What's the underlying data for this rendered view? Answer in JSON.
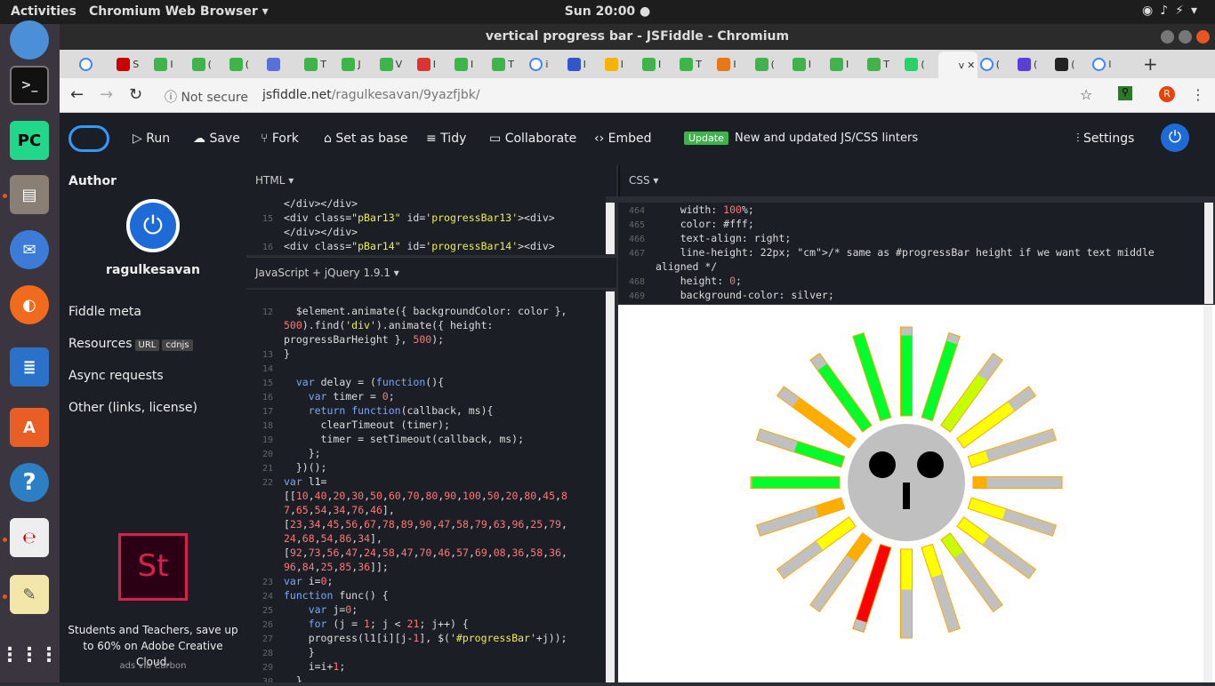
{
  "system": {
    "activities": "Activities",
    "app_menu": "Chromium Web Browser ▾",
    "clock": "Sun 20:00 ●"
  },
  "window": {
    "title": "vertical progress bar - JSFiddle - Chromium"
  },
  "tabs": [
    {
      "letter": "",
      "color": "#fff",
      "active": false
    },
    {
      "letter": "S",
      "color": "#c00",
      "active": false
    },
    {
      "letter": "I",
      "color": "#3fb44a",
      "active": false
    },
    {
      "letter": "(",
      "color": "#3fb44a",
      "active": false
    },
    {
      "letter": "(",
      "color": "#3fb44a",
      "active": false
    },
    {
      "letter": "",
      "color": "#5a6fd8",
      "active": false
    },
    {
      "letter": "T",
      "color": "#3fb44a",
      "active": false
    },
    {
      "letter": "J",
      "color": "#3fb44a",
      "active": false
    },
    {
      "letter": "V",
      "color": "#3fb44a",
      "active": false
    },
    {
      "letter": "I",
      "color": "#d33",
      "active": false
    },
    {
      "letter": "I",
      "color": "#3fb44a",
      "active": false
    },
    {
      "letter": "T",
      "color": "#3fb44a",
      "active": false
    },
    {
      "letter": "i",
      "color": "#fff",
      "active": false
    },
    {
      "letter": "I",
      "color": "#3355cc",
      "active": false
    },
    {
      "letter": "I",
      "color": "#f5b400",
      "active": false
    },
    {
      "letter": "I",
      "color": "#3fb44a",
      "active": false
    },
    {
      "letter": "T",
      "color": "#3fb44a",
      "active": false
    },
    {
      "letter": "I",
      "color": "#e8771a",
      "active": false
    },
    {
      "letter": "(",
      "color": "#3fb44a",
      "active": false
    },
    {
      "letter": "I",
      "color": "#3fb44a",
      "active": false
    },
    {
      "letter": "I",
      "color": "#3fb44a",
      "active": false
    },
    {
      "letter": "T",
      "color": "#3fb44a",
      "active": false
    },
    {
      "letter": "(",
      "color": "#25d366",
      "active": false
    },
    {
      "letter": "v",
      "color": "#f4f4f4",
      "active": true
    },
    {
      "letter": "(",
      "color": "#fff",
      "active": false
    },
    {
      "letter": "(",
      "color": "#5a3fd8",
      "active": false
    },
    {
      "letter": "(",
      "color": "#222",
      "active": false
    },
    {
      "letter": "l",
      "color": "#fff",
      "active": false
    }
  ],
  "omnibox": {
    "security": "Not secure",
    "host": "jsfiddle.net",
    "path": "/ragulkesavan/9yazfjbk/",
    "profile": "R"
  },
  "toolbar": {
    "run": "Run",
    "save": "Save",
    "fork": "Fork",
    "set_base": "Set as base",
    "tidy": "Tidy",
    "collaborate": "Collaborate",
    "embed": "Embed",
    "update_badge": "Update",
    "update_text": "New and updated JS/CSS linters",
    "settings": "Settings"
  },
  "sidebar": {
    "author_heading": "Author",
    "username": "ragulkesavan",
    "items": [
      "Fiddle meta",
      "Resources",
      "Async requests",
      "Other (links, license)"
    ],
    "resource_tags": [
      "URL",
      "cdnjs"
    ],
    "ad_logo": "St",
    "ad_text": "Students and Teachers, save up to 60% on Adobe Creative Cloud.",
    "ad_credit": "ads via Carbon"
  },
  "panels": {
    "html": "HTML ▾",
    "js": "JavaScript + jQuery 1.9.1 ▾",
    "css": "CSS ▾"
  },
  "html_code": [
    {
      "n": "",
      "t": "</div></div>"
    },
    {
      "n": "15",
      "t": "<div class=\"pBar13\" id='progressBar13'><div>"
    },
    {
      "n": "",
      "t": "</div></div>"
    },
    {
      "n": "16",
      "t": "<div class=\"pBar14\" id='progressBar14'><div>"
    }
  ],
  "css_code": [
    {
      "n": "464",
      "t": "    width: 100%;"
    },
    {
      "n": "465",
      "t": "    color: #fff;"
    },
    {
      "n": "466",
      "t": "    text-align: right;"
    },
    {
      "n": "467",
      "t": "    line-height: 22px; /* same as #progressBar height if we want text middle"
    },
    {
      "n": "",
      "t": "aligned */"
    },
    {
      "n": "468",
      "t": "    height: 0;"
    },
    {
      "n": "469",
      "t": "    background-color: silver;"
    }
  ],
  "js_code": [
    {
      "n": "",
      "t": ""
    },
    {
      "n": "12",
      "t": "  $element.animate({ backgroundColor: color },"
    },
    {
      "n": "",
      "t": "500).find('div').animate({ height:"
    },
    {
      "n": "",
      "t": "progressBarHeight }, 500);"
    },
    {
      "n": "13",
      "t": "}"
    },
    {
      "n": "14",
      "t": ""
    },
    {
      "n": "15",
      "t": "  var delay = (function(){"
    },
    {
      "n": "16",
      "t": "    var timer = 0;"
    },
    {
      "n": "17",
      "t": "    return function(callback, ms){"
    },
    {
      "n": "18",
      "t": "      clearTimeout (timer);"
    },
    {
      "n": "19",
      "t": "      timer = setTimeout(callback, ms);"
    },
    {
      "n": "20",
      "t": "    };"
    },
    {
      "n": "21",
      "t": "  })();"
    },
    {
      "n": "22",
      "t": "var l1="
    },
    {
      "n": "",
      "t": "[[10,40,20,30,50,60,70,80,90,100,50,20,80,45,8"
    },
    {
      "n": "",
      "t": "7,65,54,34,76,46],"
    },
    {
      "n": "",
      "t": "[23,34,45,56,67,78,89,90,47,58,79,63,96,25,79,"
    },
    {
      "n": "",
      "t": "24,68,54,86,34],"
    },
    {
      "n": "",
      "t": "[92,73,56,47,24,58,47,70,46,57,69,08,36,58,36,"
    },
    {
      "n": "",
      "t": "96,84,25,85,36]];"
    },
    {
      "n": "23",
      "t": "var i=0;"
    },
    {
      "n": "24",
      "t": "function func() {"
    },
    {
      "n": "25",
      "t": "    var j=0;"
    },
    {
      "n": "26",
      "t": "    for (j = 1; j < 21; j++) {"
    },
    {
      "n": "27",
      "t": "    progress(l1[i][j-1], $('#progressBar'+j));"
    },
    {
      "n": "28",
      "t": "    }"
    },
    {
      "n": "29",
      "t": "    i=i+1;"
    },
    {
      "n": "30",
      "t": "  }"
    }
  ],
  "colors": {
    "green": "#00ff2a",
    "yellow": "#ffff00",
    "orange": "#ffae00",
    "red": "#ff0000",
    "lime": "#c5ff00",
    "empty": "silver",
    "border": "#ffa500",
    "face": "#c0c0c0"
  },
  "progress_bars": [
    {
      "level": 0.1,
      "color": "green"
    },
    {
      "level": 0.1,
      "color": "green"
    },
    {
      "level": 0.3,
      "color": "lime"
    },
    {
      "level": 0.3,
      "color": "yellow"
    },
    {
      "level": 0.8,
      "color": "yellow"
    },
    {
      "level": 0.85,
      "color": "orange"
    },
    {
      "level": 0.6,
      "color": "yellow"
    },
    {
      "level": 0.65,
      "color": "yellow"
    },
    {
      "level": 0.75,
      "color": "lime"
    },
    {
      "level": 0.65,
      "color": "yellow"
    },
    {
      "level": 0.55,
      "color": "yellow"
    },
    {
      "level": 0.12,
      "color": "red"
    },
    {
      "level": 0.7,
      "color": "orange"
    },
    {
      "level": 0.55,
      "color": "yellow"
    },
    {
      "level": 0.7,
      "color": "orange"
    },
    {
      "level": 0.02,
      "color": "green"
    },
    {
      "level": 0.45,
      "color": "green"
    },
    {
      "level": 0.22,
      "color": "orange"
    },
    {
      "level": 0.15,
      "color": "green"
    },
    {
      "level": 0.0,
      "color": "green"
    }
  ]
}
